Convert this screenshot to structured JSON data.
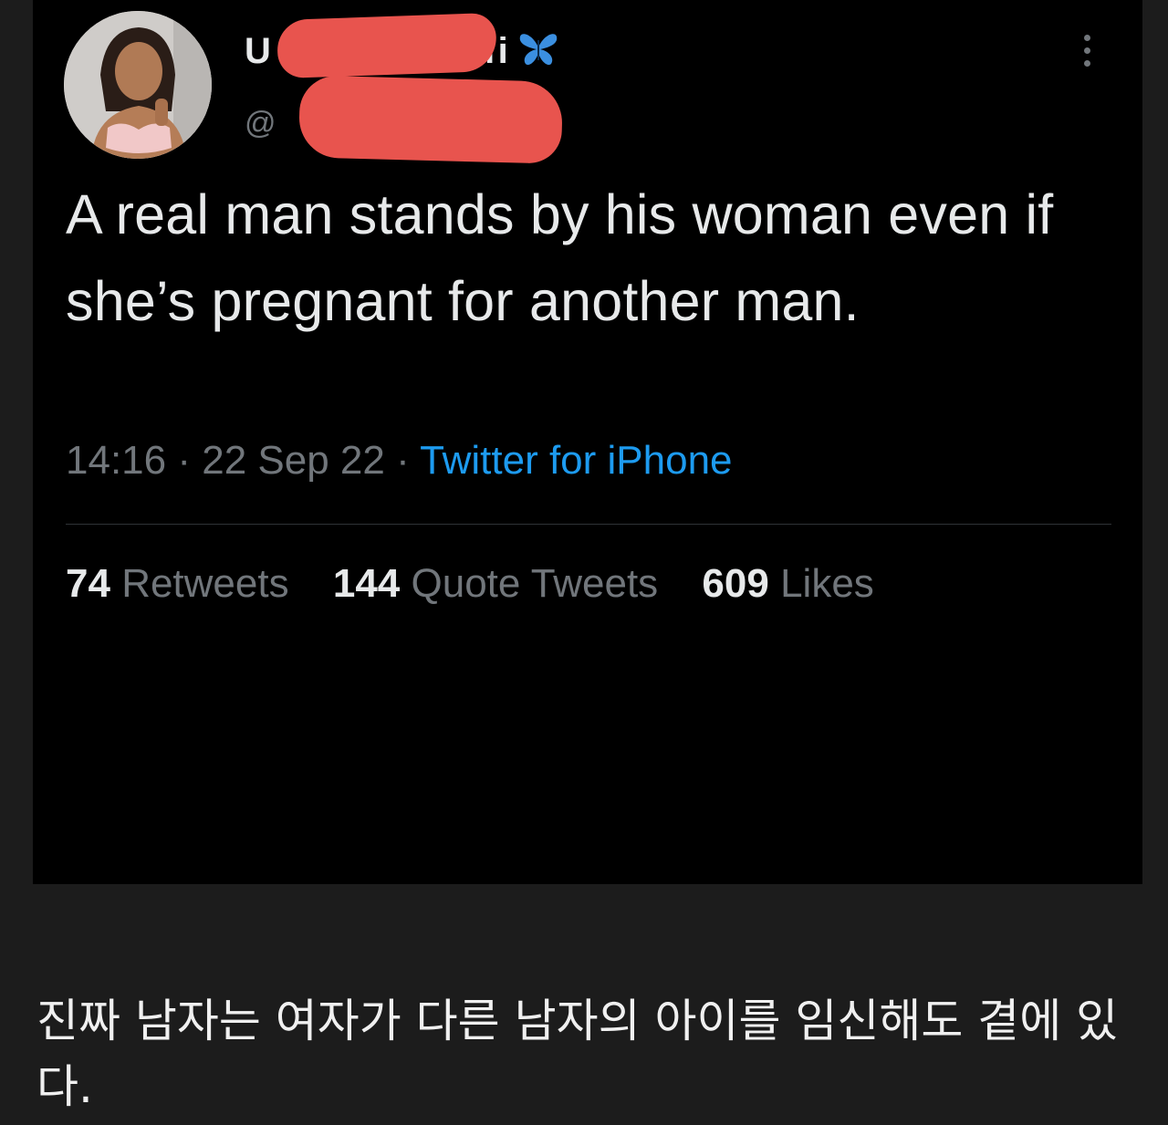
{
  "tweet": {
    "display_name_visible": "l i",
    "display_name_prefix": "U",
    "handle_prefix": "@",
    "badge_icon": "butterfly-icon",
    "more_icon": "more-options-icon",
    "text": "A real man stands by his woman even if she’s pregnant for another man.",
    "time": "14:16",
    "date": "22 Sep 22",
    "separator": " · ",
    "source": "Twitter for iPhone",
    "stats": [
      {
        "count": "74",
        "label": "Retweets"
      },
      {
        "count": "144",
        "label": "Quote Tweets"
      },
      {
        "count": "609",
        "label": "Likes"
      }
    ]
  },
  "colors": {
    "page_background": "#1c1c1c",
    "tweet_background": "#000000",
    "redaction": "#e8544e",
    "link": "#1d9bf0",
    "badge": "#3b8fe0"
  },
  "caption": {
    "text": "진짜 남자는 여자가 다른 남자의 아이를 임신해도 곁에 있다."
  }
}
